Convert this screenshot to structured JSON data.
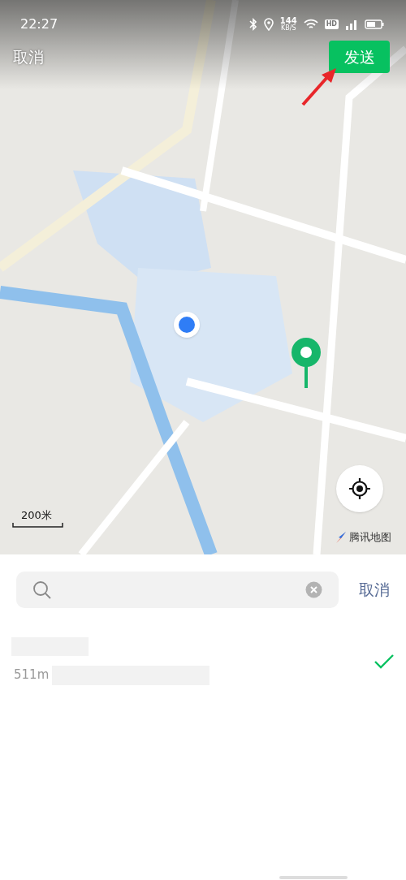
{
  "status_bar": {
    "time": "22:27",
    "speed": "144",
    "speed_unit": "KB/S",
    "network": "HD"
  },
  "top_bar": {
    "cancel": "取消",
    "send": "发送"
  },
  "map": {
    "scale": "200米",
    "provider": "腾讯地图"
  },
  "search": {
    "cancel": "取消"
  },
  "results": [
    {
      "distance": "511m",
      "selected": true
    }
  ]
}
